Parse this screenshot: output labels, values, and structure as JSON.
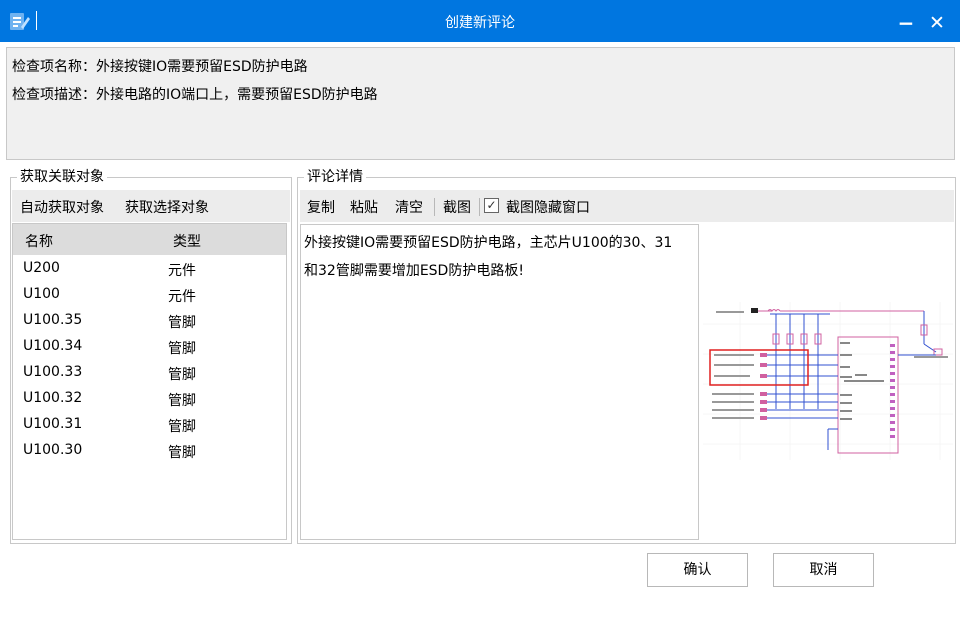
{
  "window": {
    "title": "创建新评论",
    "icon": "edit-note-icon",
    "minimize_glyph": "−",
    "close_glyph": "✕"
  },
  "check_item": {
    "name_line": "检查项名称：外接按键IO需要预留ESD防护电路",
    "desc_line": "检查项描述：外接电路的IO端口上，需要预留ESD防护电路"
  },
  "related": {
    "group_title": "获取关联对象",
    "auto_get_label": "自动获取对象",
    "get_selected_label": "获取选择对象",
    "columns": [
      "名称",
      "类型"
    ],
    "rows": [
      {
        "name": "U200",
        "type": "元件"
      },
      {
        "name": "U100",
        "type": "元件"
      },
      {
        "name": "U100.35",
        "type": "管脚"
      },
      {
        "name": "U100.34",
        "type": "管脚"
      },
      {
        "name": "U100.33",
        "type": "管脚"
      },
      {
        "name": "U100.32",
        "type": "管脚"
      },
      {
        "name": "U100.31",
        "type": "管脚"
      },
      {
        "name": "U100.30",
        "type": "管脚"
      }
    ]
  },
  "comment": {
    "group_title": "评论详情",
    "copy_label": "复制",
    "paste_label": "粘贴",
    "clear_label": "清空",
    "screenshot_label": "截图",
    "hide_window_checked": true,
    "hide_window_label": "截图隐藏窗口",
    "text_line1": "外接按键IO需要预留ESD防护电路，主芯片U100的30、31",
    "text_line2": "和32管脚需要增加ESD防护电路板!"
  },
  "actions": {
    "confirm_label": "确认",
    "cancel_label": "取消"
  },
  "colors": {
    "titlebar": "#0076e0",
    "highlight_box": "#e02020",
    "schematic_pink": "#d060a0",
    "schematic_blue": "#3050d0"
  }
}
